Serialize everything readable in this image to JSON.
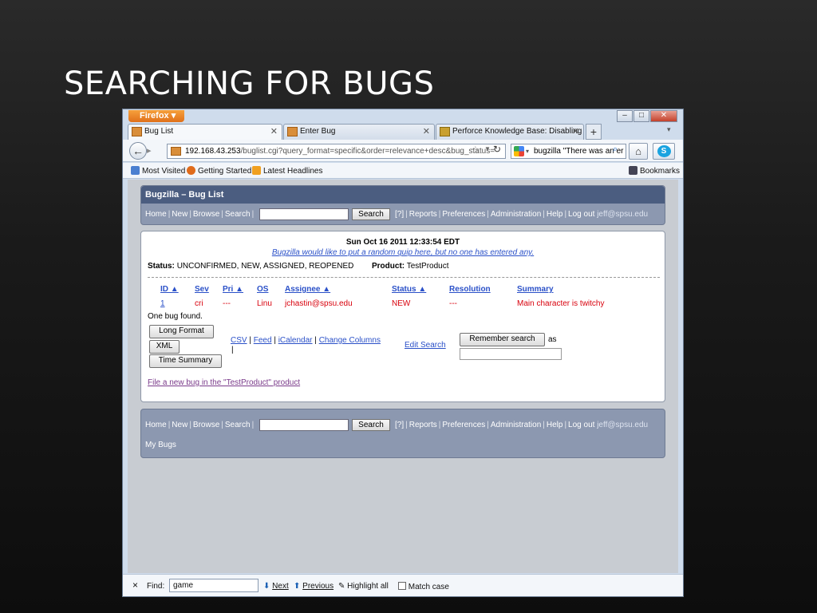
{
  "slide": {
    "title": "SEARCHING FOR BUGS"
  },
  "browser": {
    "menu_button": "Firefox",
    "window_controls": {
      "minimize": "–",
      "maximize": "□",
      "close": "✕"
    },
    "tabs": [
      {
        "label": "Bug List"
      },
      {
        "label": "Enter Bug"
      },
      {
        "label": "Perforce Knowledge Base: Disabling ..."
      }
    ],
    "new_tab": "+",
    "url_host": "192.168.43.253",
    "url_path": "/buglist.cgi?query_format=specific&order=relevance+desc&bug_status=",
    "search_value": "bugzilla \"There was an er",
    "bookmarks": [
      {
        "label": "Most Visited",
        "color": "#4a7fd0"
      },
      {
        "label": "Getting Started",
        "color": "#e06b1a"
      },
      {
        "label": "Latest Headlines",
        "color": "#f0a020"
      }
    ],
    "bookmarks_menu": "Bookmarks"
  },
  "bugzilla": {
    "page_title": "Bugzilla – Bug List",
    "nav_links": [
      "Home",
      "New",
      "Browse",
      "Search"
    ],
    "nav_links_right": [
      "[?]",
      "Reports",
      "Preferences",
      "Administration",
      "Help",
      "Log out"
    ],
    "user": "jeff@spsu.edu",
    "search_button": "Search",
    "timestamp": "Sun Oct 16 2011 12:33:54 EDT",
    "quip": "Bugzilla would like to put a random quip here, but no one has entered any.",
    "status_label": "Status:",
    "status_value": "UNCONFIRMED, NEW, ASSIGNED, REOPENED",
    "product_label": "Product:",
    "product_value": "TestProduct",
    "columns": [
      "ID ▲",
      "Sev",
      "Pri ▲",
      "OS",
      "Assignee ▲",
      "Status ▲",
      "Resolution",
      "Summary"
    ],
    "rows": [
      {
        "id": "1",
        "sev": "cri",
        "pri": "---",
        "os": "Linu",
        "assignee": "jchastin@spsu.edu",
        "status": "NEW",
        "resolution": "---",
        "summary": "Main character is twitchy"
      }
    ],
    "bug_count": "One bug found.",
    "buttons": {
      "long_format": "Long Format",
      "xml": "XML",
      "time_summary": "Time Summary",
      "remember": "Remember search"
    },
    "formats": [
      "CSV",
      "Feed",
      "iCalendar",
      "Change Columns"
    ],
    "format_sep": "|",
    "edit_search": "Edit Search",
    "as_label": "as",
    "file_new": "File a new bug in the \"TestProduct\" product",
    "my_bugs": "My Bugs"
  },
  "findbar": {
    "close": "×",
    "find_label": "Find:",
    "find_value": "game",
    "next": "Next",
    "previous": "Previous",
    "highlight": "Highlight all",
    "match_case": "Match case"
  }
}
